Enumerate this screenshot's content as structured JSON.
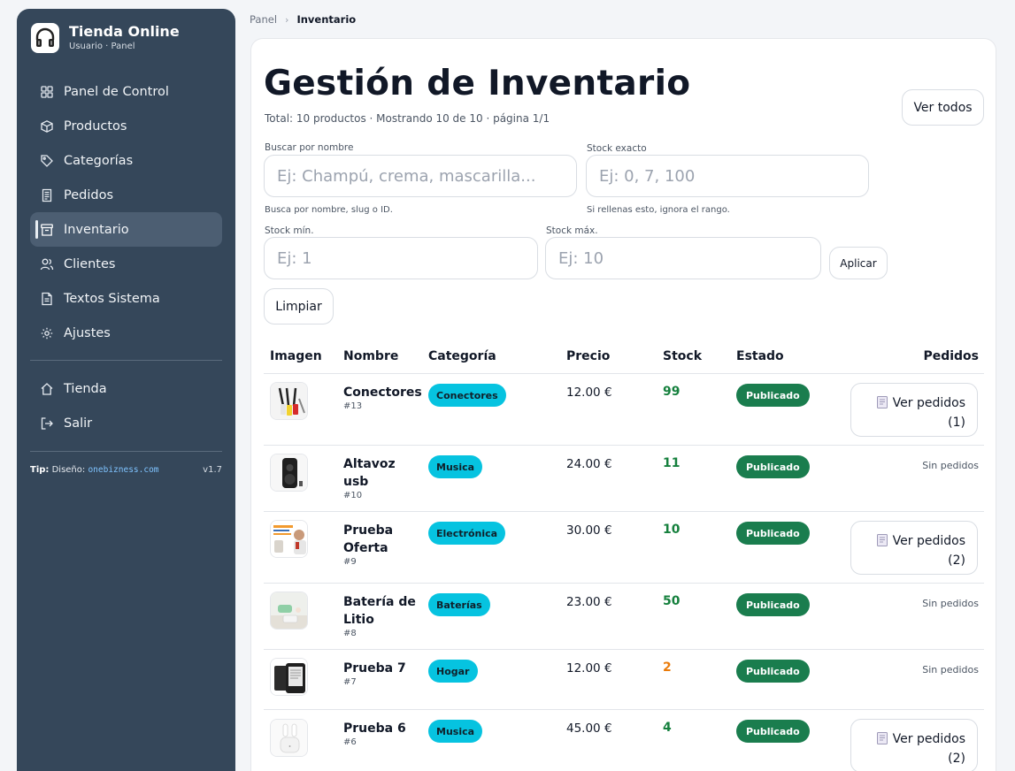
{
  "brand": {
    "title": "Tienda Online",
    "subtitle": "Usuario · Panel"
  },
  "sidebar": {
    "items": [
      {
        "label": "Panel de Control",
        "icon": "grid-icon"
      },
      {
        "label": "Productos",
        "icon": "box-icon"
      },
      {
        "label": "Categorías",
        "icon": "tag-icon"
      },
      {
        "label": "Pedidos",
        "icon": "receipt-icon"
      },
      {
        "label": "Inventario",
        "icon": "archive-icon",
        "active": true
      },
      {
        "label": "Clientes",
        "icon": "users-icon"
      },
      {
        "label": "Textos Sistema",
        "icon": "document-icon"
      },
      {
        "label": "Ajustes",
        "icon": "gear-icon"
      }
    ],
    "secondary": [
      {
        "label": "Tienda",
        "icon": "home-icon"
      },
      {
        "label": "Salir",
        "icon": "logout-icon"
      }
    ],
    "tip_label": "Tip:",
    "tip_text": " Diseño: ",
    "tip_link": "onebizness.com",
    "version": "v1.7"
  },
  "breadcrumb": {
    "parent": "Panel",
    "separator": "›",
    "current": "Inventario"
  },
  "page": {
    "title": "Gestión de Inventario",
    "summary": "Total: 10 productos · Mostrando 10 de 10 · página 1/1",
    "view_all": "Ver todos"
  },
  "filters": {
    "search_label": "Buscar por nombre",
    "search_placeholder": "Ej: Champú, crema, mascarilla...",
    "search_hint": "Busca por nombre, slug o ID.",
    "exact_label": "Stock exacto",
    "exact_placeholder": "Ej: 0, 7, 100",
    "exact_hint": "Si rellenas esto, ignora el rango.",
    "min_label": "Stock mín.",
    "min_placeholder": "Ej: 1",
    "max_label": "Stock máx.",
    "max_placeholder": "Ej: 10",
    "apply": "Aplicar",
    "clear": "Limpiar"
  },
  "table": {
    "headers": [
      "Imagen",
      "Nombre",
      "Categoría",
      "Precio",
      "Stock",
      "Estado",
      "Pedidos"
    ],
    "rows": [
      {
        "name": "Conectores",
        "id": "#13",
        "category": "Conectores",
        "price": "12.00 €",
        "stock": "99",
        "stock_level": "ok",
        "status": "Publicado",
        "orders_label": "Ver pedidos",
        "orders_count": "(1)"
      },
      {
        "name": "Altavoz usb",
        "id": "#10",
        "category": "Musica",
        "price": "24.00 €",
        "stock": "11",
        "stock_level": "ok",
        "status": "Publicado",
        "no_orders": "Sin pedidos"
      },
      {
        "name": "Prueba Oferta",
        "id": "#9",
        "category": "Electrónica",
        "price": "30.00 €",
        "stock": "10",
        "stock_level": "ok",
        "status": "Publicado",
        "orders_label": "Ver pedidos",
        "orders_count": "(2)"
      },
      {
        "name": "Batería de Litio",
        "id": "#8",
        "category": "Baterías",
        "price": "23.00 €",
        "stock": "50",
        "stock_level": "ok",
        "status": "Publicado",
        "no_orders": "Sin pedidos"
      },
      {
        "name": "Prueba 7",
        "id": "#7",
        "category": "Hogar",
        "price": "12.00 €",
        "stock": "2",
        "stock_level": "low",
        "status": "Publicado",
        "no_orders": "Sin pedidos"
      },
      {
        "name": "Prueba 6",
        "id": "#6",
        "category": "Musica",
        "price": "45.00 €",
        "stock": "4",
        "stock_level": "ok",
        "status": "Publicado",
        "orders_label": "Ver pedidos",
        "orders_count": "(2)"
      }
    ]
  },
  "colors": {
    "sidebar": "#35475a",
    "category_badge": "#06c3e0",
    "status_badge": "#1a7d4e",
    "stock_ok": "#15803d",
    "stock_low": "#ea7b0a"
  }
}
